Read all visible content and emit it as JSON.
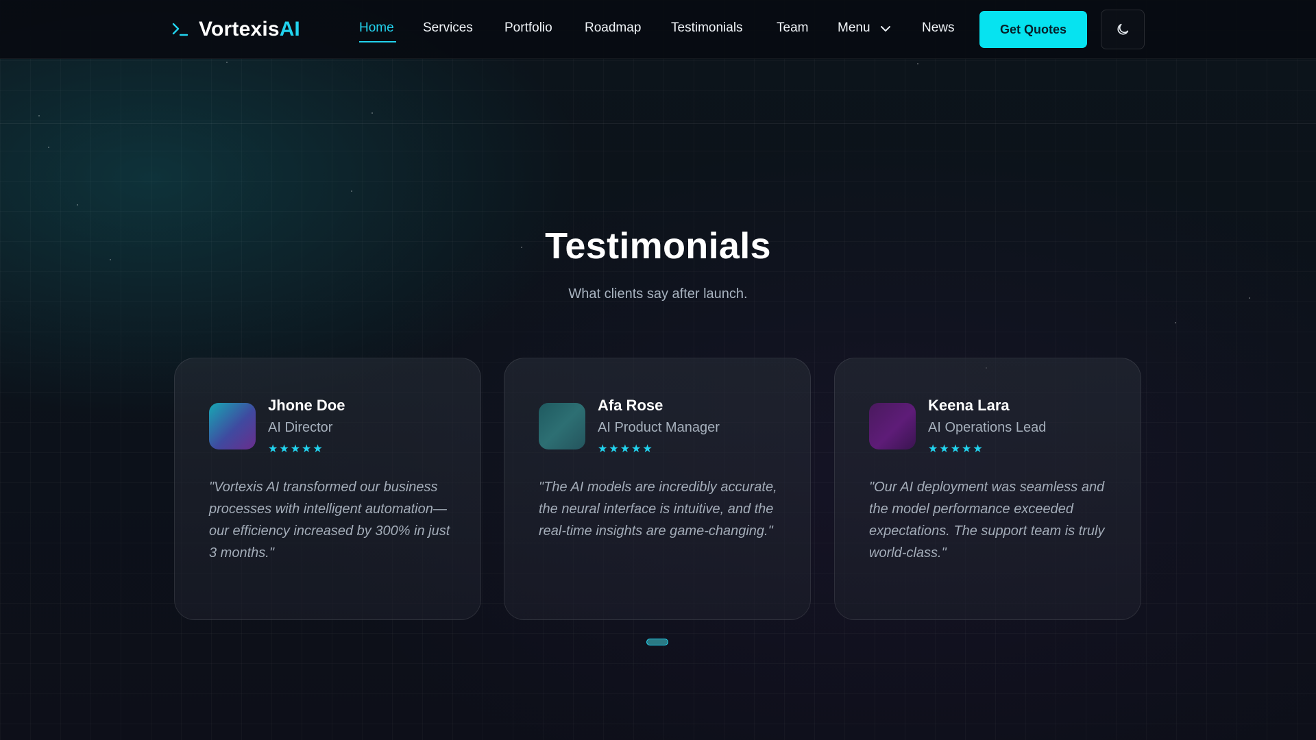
{
  "brand": {
    "name": "Vortexis",
    "accent": "AI",
    "icon": "terminal-prompt-icon",
    "accent_color": "#22d3ee"
  },
  "nav": {
    "links": [
      "Home",
      "Services",
      "Portfolio",
      "Roadmap",
      "Testimonials",
      "Team",
      "Menu",
      "News"
    ],
    "active": "Home",
    "menu_icon": "chevron-down-icon",
    "cta": "Get Quotes",
    "theme_toggle_icon": "moon-icon"
  },
  "section": {
    "title": "Testimonials",
    "subtitle": "What clients say after launch."
  },
  "testimonials": [
    {
      "name": "Jhone Doe",
      "role": "AI Director",
      "rating": 5,
      "stars": "★★★★★",
      "quote": "\"Vortexis AI transformed our business processes with intelligent automation—our efficiency increased by 300% in just 3 months.\""
    },
    {
      "name": "Afa Rose",
      "role": "AI Product Manager",
      "rating": 5,
      "stars": "★★★★★",
      "quote": "\"The AI models are incredibly accurate, the neural interface is intuitive, and the real-time insights are game-changing.\""
    },
    {
      "name": "Keena Lara",
      "role": "AI Operations Lead",
      "rating": 5,
      "stars": "★★★★★",
      "quote": "\"Our AI deployment was seamless and the model performance exceeded expectations. The support team is truly world-class.\""
    }
  ],
  "pager": {
    "active_index": 0
  },
  "colors": {
    "background": "#0b0f17",
    "cta_bg": "#06e3f0",
    "star": "#22d3ee"
  }
}
